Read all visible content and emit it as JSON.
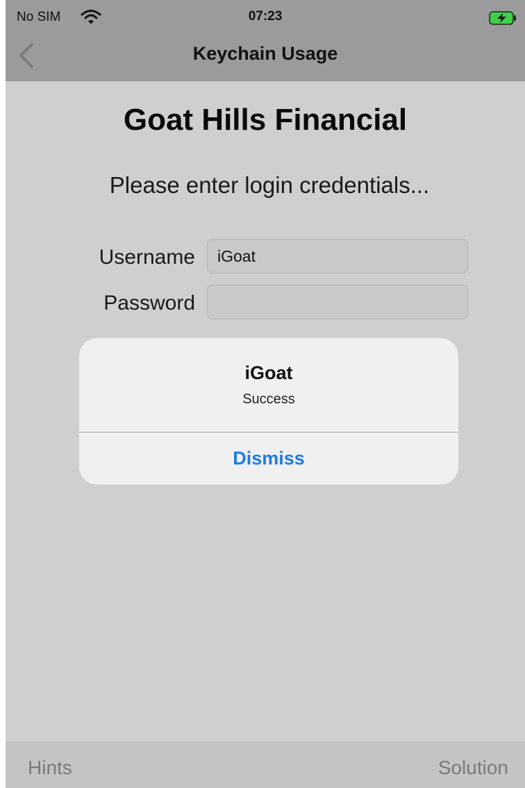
{
  "status_bar": {
    "carrier": "No SIM",
    "time": "07:23"
  },
  "nav": {
    "title": "Keychain Usage"
  },
  "main": {
    "app_title": "Goat Hills Financial",
    "prompt": "Please enter login credentials...",
    "username_label": "Username",
    "username_value": "iGoat",
    "password_label": "Password",
    "password_value": ""
  },
  "alert": {
    "title": "iGoat",
    "message": "Success",
    "button": "Dismiss"
  },
  "toolbar": {
    "left": "Hints",
    "right": "Solution"
  },
  "colors": {
    "accent": "#1e7be6",
    "battery_fill": "#3fcf4a"
  },
  "icons": [
    "wifi-icon",
    "battery-icon",
    "back-chevron-icon"
  ]
}
